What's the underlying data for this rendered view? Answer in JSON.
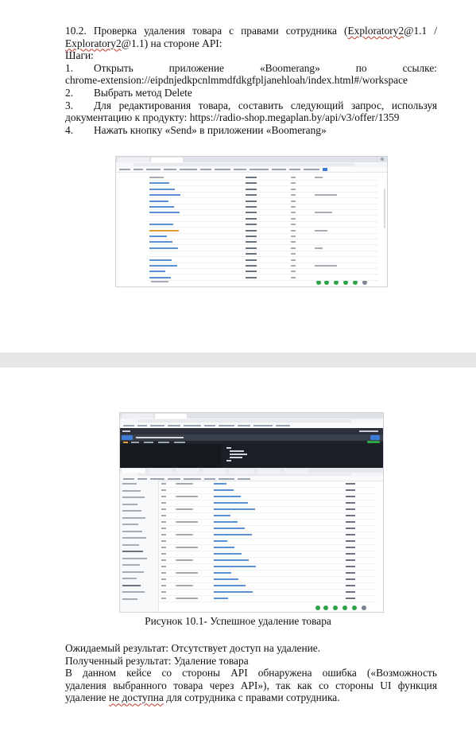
{
  "section": {
    "heading_line1": "10.2. Проверка удаления товара с правами сотрудника (Exploratory2@1.1 /",
    "heading_line2": "Exploratory2@1.1) на стороне API:",
    "steps_label": "Шаги:",
    "steps": [
      {
        "num": "1.",
        "line1": "Открыть приложение «Boomerang» по ссылке:",
        "line2": "chrome-extension://eipdnjedkpcnlmmdfdkgfpljanehloah/index.html#/workspace"
      },
      {
        "num": "2.",
        "line1": "Выбрать метод Delete"
      },
      {
        "num": "3.",
        "line1": "Для редактирования товара, составить следующий запрос, используя",
        "line2": "документацию к продукту: https://radio-shop.megaplan.by/api/v3/offer/1359"
      },
      {
        "num": "4.",
        "line1": "Нажать кнопку «Send» в приложении «Boomerang»"
      }
    ]
  },
  "figure": {
    "caption": "Рисунок 10.1- Успешное удаление товара"
  },
  "results": {
    "expected": "Ожидаемый результат: Отсутствует доступ на удаление.",
    "actual": "Полученный результат: Удаление товара",
    "note_line1": "В данном кейсе со стороны API обнаружена ошибка («Возможность",
    "note_line2": "удаления выбранного товара через API»), так как со стороны UI функция",
    "note_line3_a": "удаление ",
    "note_line3_b": "не доступна",
    "note_line3_c": " для сотрудника с правами сотрудника."
  }
}
